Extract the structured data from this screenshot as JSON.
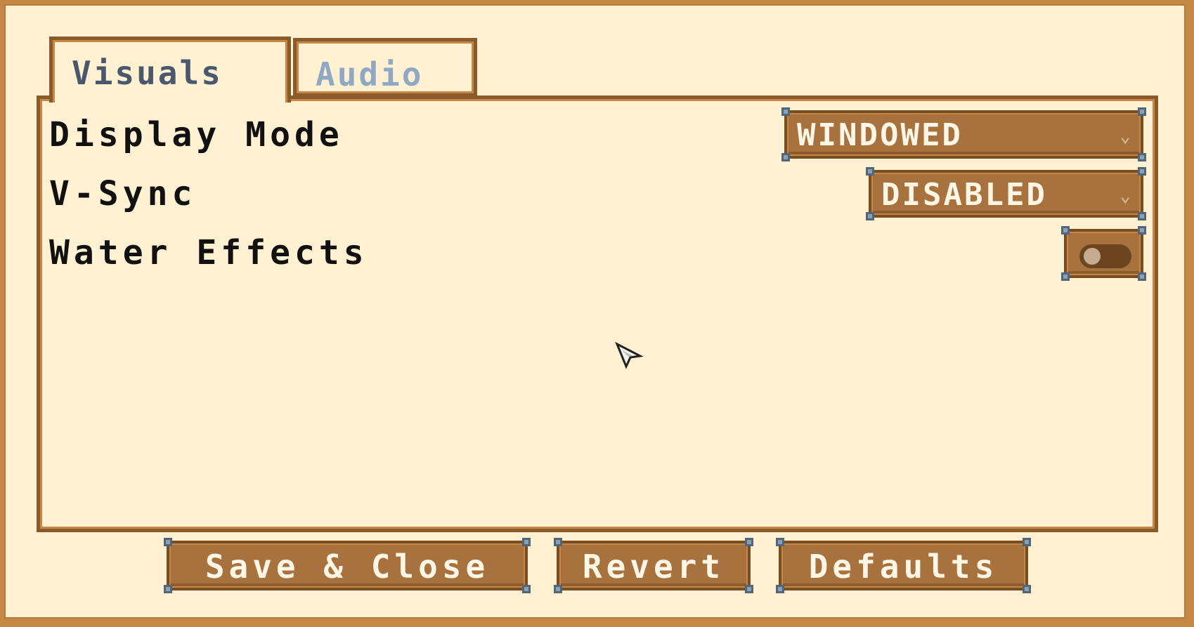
{
  "tabs": [
    {
      "label": "Visuals",
      "active": true
    },
    {
      "label": "Audio",
      "active": false
    }
  ],
  "settings": {
    "display_mode": {
      "label": "Display Mode",
      "value": "WINDOWED"
    },
    "vsync": {
      "label": "V-Sync",
      "value": "DISABLED"
    },
    "water_effects": {
      "label": "Water Effects",
      "enabled": false
    }
  },
  "buttons": {
    "save_close": "Save & Close",
    "revert": "Revert",
    "defaults": "Defaults"
  },
  "colors": {
    "background": "#fff1d2",
    "outer_border": "#c48746",
    "control_fill": "#a8723f",
    "active_tab_text": "#4a586e",
    "inactive_tab_text": "#8fa8c4"
  },
  "icons": {
    "dropdown": "chevron-down-icon",
    "pointer": "mouse-cursor-icon"
  }
}
